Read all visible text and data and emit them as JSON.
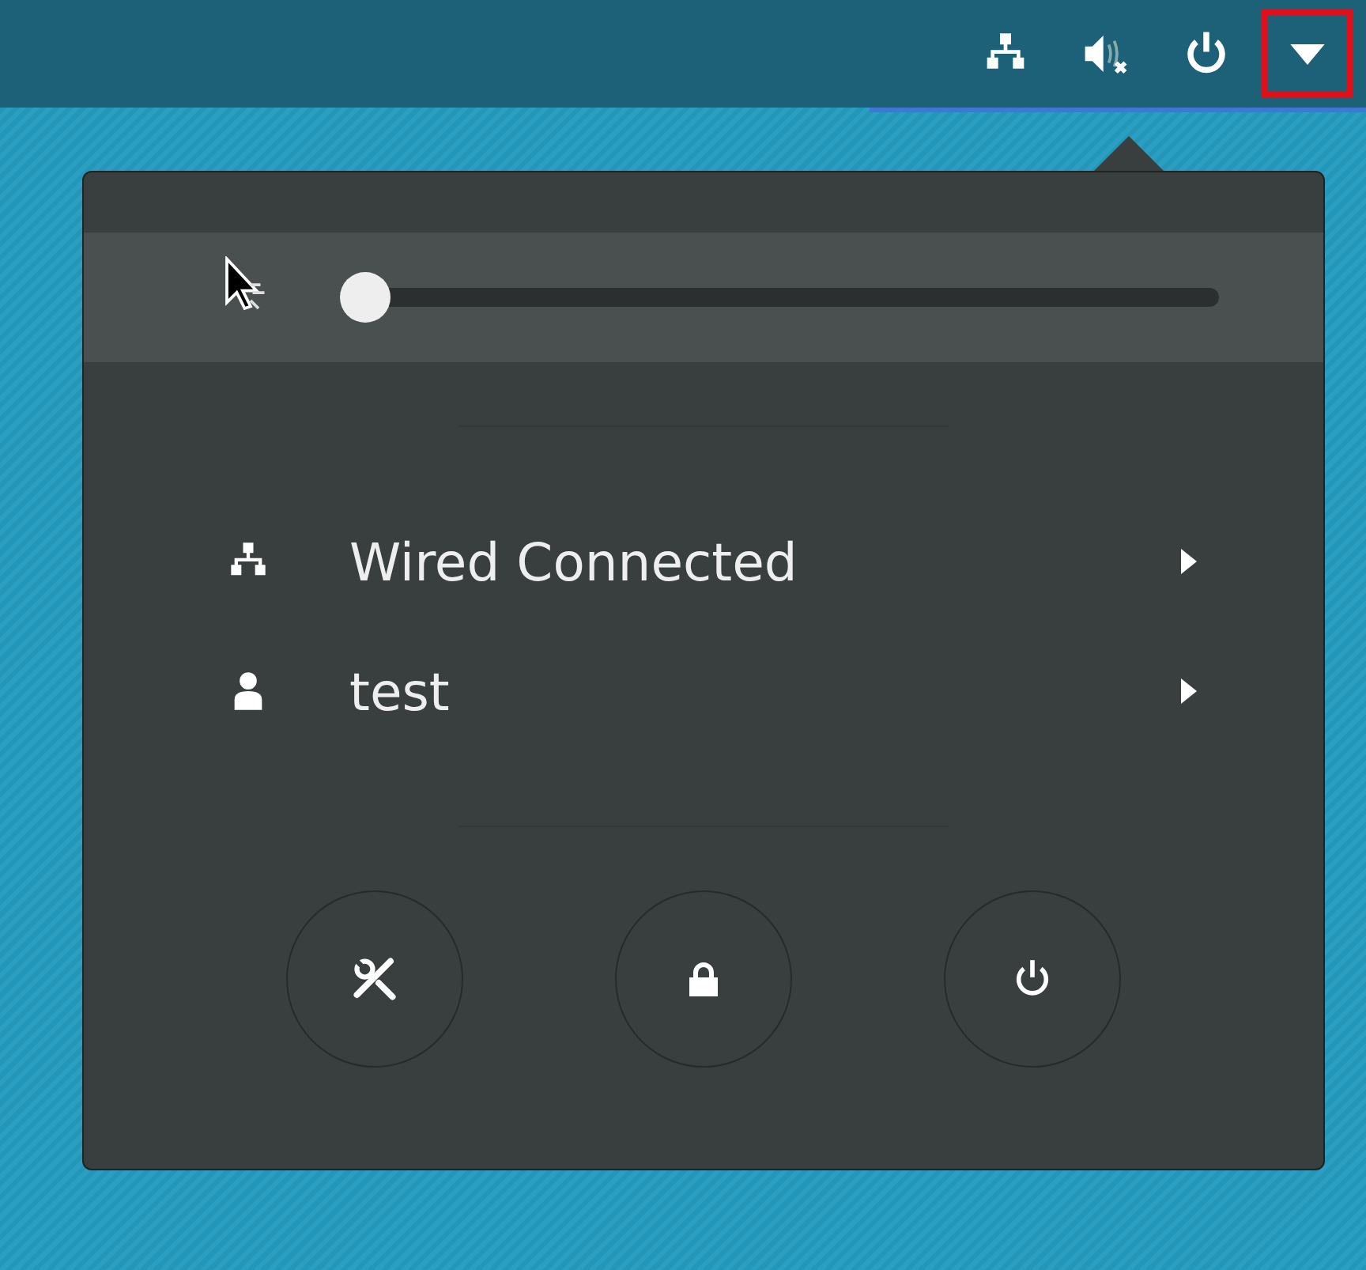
{
  "top_bar": {
    "indicators": [
      {
        "kind": "network"
      },
      {
        "kind": "volume-muted"
      },
      {
        "kind": "power"
      },
      {
        "kind": "dropdown",
        "highlighted": true
      }
    ]
  },
  "menu": {
    "volume": {
      "level": 0
    },
    "items": [
      {
        "kind": "network",
        "label": "Wired Connected"
      },
      {
        "kind": "user",
        "label": "test"
      }
    ],
    "buttons": [
      {
        "kind": "settings"
      },
      {
        "kind": "lock"
      },
      {
        "kind": "power"
      }
    ]
  }
}
